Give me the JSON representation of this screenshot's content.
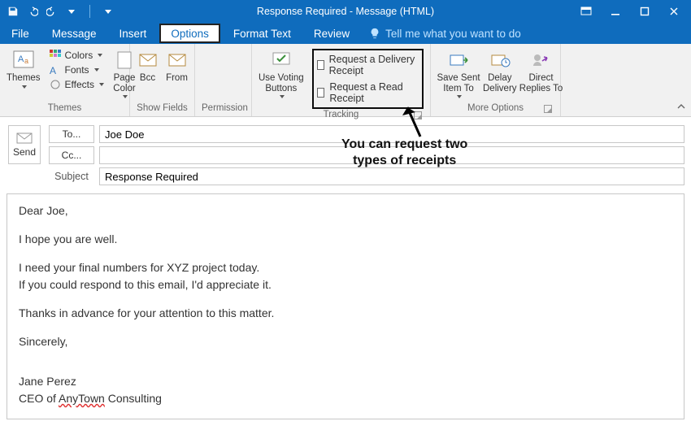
{
  "title": "Response Required  -  Message (HTML)",
  "qat": {
    "customize_tip": "Customize Quick Access Toolbar"
  },
  "tabs": {
    "file": "File",
    "message": "Message",
    "insert": "Insert",
    "options": "Options",
    "format_text": "Format Text",
    "review": "Review",
    "tell_me": "Tell me what you want to do"
  },
  "ribbon": {
    "themes": {
      "group": "Themes",
      "themes_btn": "Themes",
      "colors": "Colors",
      "fonts": "Fonts",
      "effects": "Effects",
      "page_color": "Page\nColor"
    },
    "show_fields": {
      "group": "Show Fields",
      "bcc": "Bcc",
      "from": "From"
    },
    "permission": {
      "group": "Permission"
    },
    "tracking": {
      "group": "Tracking",
      "use_voting": "Use Voting\nButtons",
      "delivery_receipt": "Request a Delivery Receipt",
      "read_receipt": "Request a Read Receipt"
    },
    "more_options": {
      "group": "More Options",
      "save_sent": "Save Sent\nItem To",
      "delay_delivery": "Delay\nDelivery",
      "direct_replies": "Direct\nReplies To"
    }
  },
  "fields": {
    "to_btn": "To...",
    "cc_btn": "Cc...",
    "subject_label": "Subject",
    "to_value": "Joe Doe",
    "cc_value": "",
    "subject_value": "Response Required",
    "send": "Send"
  },
  "body": {
    "greeting": "Dear Joe,",
    "l1": "I hope you are well.",
    "l2": "I need your final numbers for XYZ project today.",
    "l3": "If you could respond to this email, I'd appreciate it.",
    "l4": "Thanks in advance for your attention to this matter.",
    "closing": "Sincerely,",
    "sig_name": "Jane Perez",
    "sig_title_pre": "CEO of ",
    "sig_company": "AnyTown",
    "sig_title_post": " Consulting"
  },
  "annotation": {
    "line1": "You can request two",
    "line2": "types of receipts"
  }
}
